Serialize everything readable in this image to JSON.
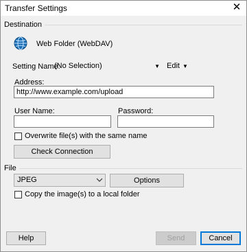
{
  "window": {
    "title": "Transfer Settings",
    "close_glyph": "✕"
  },
  "destination": {
    "group_label": "Destination",
    "service_name": "Web Folder (WebDAV)",
    "service_icon": "globe-icon",
    "setting_name_label": "Setting Name:",
    "setting_name_value": "(No Selection)",
    "edit_label": "Edit",
    "address_label": "Address:",
    "address_value": "http://www.example.com/upload",
    "user_name_label": "User Name:",
    "user_name_value": "",
    "password_label": "Password:",
    "password_value": "",
    "overwrite_label": "Overwrite file(s) with the same name",
    "overwrite_checked": false,
    "check_connection_label": "Check Connection"
  },
  "file": {
    "group_label": "File",
    "format_value": "JPEG",
    "options_label": "Options",
    "copy_local_label": "Copy the image(s) to a local folder",
    "copy_local_checked": false
  },
  "footer": {
    "help_label": "Help",
    "send_label": "Send",
    "cancel_label": "Cancel"
  }
}
